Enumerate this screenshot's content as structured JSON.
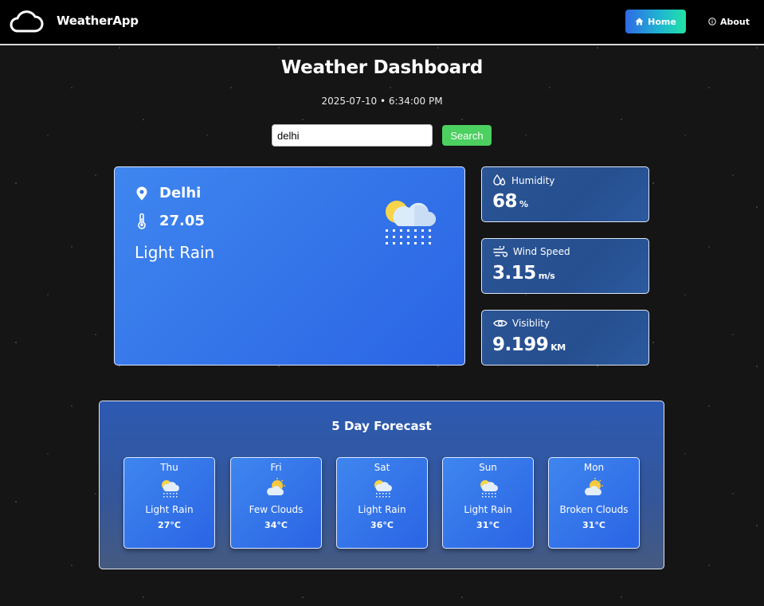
{
  "nav": {
    "brand": "WeatherApp",
    "home_label": "Home",
    "about_label": "About"
  },
  "header": {
    "title": "Weather Dashboard",
    "datetime": "2025-07-10 • 6:34:00 PM"
  },
  "search": {
    "value": "delhi",
    "button_label": "Search",
    "button_color": "#4cd060"
  },
  "current": {
    "city": "Delhi",
    "temperature": "27.05",
    "description": "Light Rain",
    "icon": "sun-cloud-rain-icon"
  },
  "stats": {
    "humidity": {
      "label": "Humidity",
      "value": "68",
      "unit": "%",
      "icon": "droplets-icon"
    },
    "wind": {
      "label": "Wind Speed",
      "value": "3.15",
      "unit": "m/s",
      "icon": "wind-icon"
    },
    "visibility": {
      "label": "Visiblity",
      "value": "9.199",
      "unit": "KM",
      "icon": "eye-icon"
    }
  },
  "forecast": {
    "title": "5 Day Forecast",
    "days": [
      {
        "day": "Thu",
        "description": "Light Rain",
        "temp": "27°C",
        "icon": "rain-icon"
      },
      {
        "day": "Fri",
        "description": "Few Clouds",
        "temp": "34°C",
        "icon": "sun-cloud-icon"
      },
      {
        "day": "Sat",
        "description": "Light Rain",
        "temp": "36°C",
        "icon": "rain-icon"
      },
      {
        "day": "Sun",
        "description": "Light Rain",
        "temp": "31°C",
        "icon": "rain-icon"
      },
      {
        "day": "Mon",
        "description": "Broken Clouds",
        "temp": "31°C",
        "icon": "sun-cloud-icon"
      }
    ]
  },
  "colors": {
    "accent": "#2f6ae6",
    "card_blue": "#3f86ef",
    "stat_blue": "#2a5494"
  }
}
